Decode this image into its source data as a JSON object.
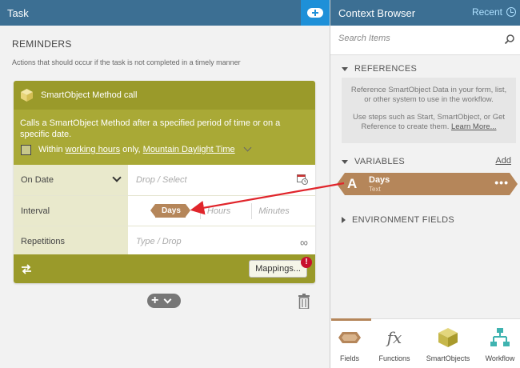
{
  "task_panel": {
    "title": "Task",
    "reminders_title": "REMINDERS",
    "reminders_desc": "Actions that should occur if the task is not completed in a timely manner"
  },
  "card": {
    "header_title": "SmartObject Method call",
    "description": "Calls a SmartObject Method after a specified period of time or on a specific date.",
    "within_prefix": "Within",
    "working_hours_link": "working hours",
    "only_text": "only,",
    "timezone_link": "Mountain Daylight Time",
    "rows": {
      "date_label": "On Date",
      "date_placeholder": "Drop / Select",
      "interval_label": "Interval",
      "interval_days": "Days",
      "interval_hours": "Hours",
      "interval_minutes": "Minutes",
      "repetitions_label": "Repetitions",
      "repetitions_placeholder": "Type / Drop",
      "repetitions_symbol": "∞"
    },
    "mappings_button": "Mappings...",
    "alert_badge": "!"
  },
  "context_browser": {
    "title": "Context Browser",
    "recent_label": "Recent",
    "search_placeholder": "Search Items",
    "references_title": "REFERENCES",
    "references_text_1": "Reference SmartObject Data in your form, list, or other system to use in the workflow.",
    "references_text_2": "Use steps such as Start, SmartObject, or Get Reference to create them.",
    "learn_more": "Learn More...",
    "variables_title": "VARIABLES",
    "add_label": "Add",
    "variable": {
      "letter": "A",
      "name": "Days",
      "type": "Text"
    },
    "environment_title": "ENVIRONMENT FIELDS",
    "tabs": [
      {
        "label": "Fields",
        "icon": "fields-icon"
      },
      {
        "label": "Functions",
        "icon": "function-icon"
      },
      {
        "label": "SmartObjects",
        "icon": "smartobject-cube-icon"
      },
      {
        "label": "Workflow",
        "icon": "workflow-icon"
      }
    ]
  },
  "colors": {
    "header_blue": "#3c6f93",
    "add_blue": "#1e90d8",
    "olive": "#9a9a2a",
    "field_tag": "#b5865a",
    "alert_red": "#c8102e",
    "arrow_red": "#e0252b"
  }
}
